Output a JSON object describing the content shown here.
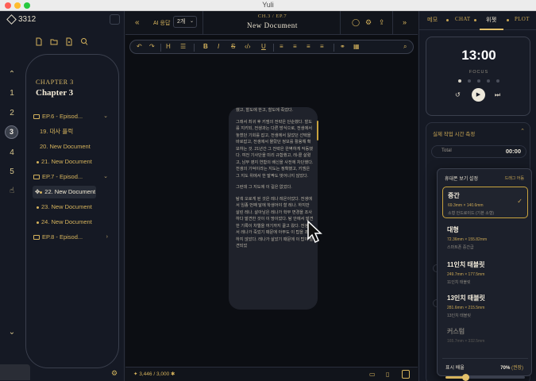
{
  "window": {
    "title": "Yuli"
  },
  "brand": {
    "name": "3312"
  },
  "rail": {
    "items": [
      "1",
      "2",
      "3",
      "4",
      "5"
    ],
    "active": "3"
  },
  "chapter": {
    "label": "CHAPTER 3",
    "title": "Chapter 3"
  },
  "tree": [
    {
      "type": "folder",
      "label": "EP.6 - Episod...",
      "chevron": "⌄"
    },
    {
      "type": "doc",
      "label": "19. 대사 플럭"
    },
    {
      "type": "doc",
      "label": "20. New Document"
    },
    {
      "type": "doc",
      "label": "21. New Document"
    },
    {
      "type": "folder",
      "label": "EP.7 - Episod...",
      "chevron": "⌄"
    },
    {
      "type": "doc",
      "label": "22. New Document",
      "active": true
    },
    {
      "type": "doc",
      "label": "23. New Document"
    },
    {
      "type": "doc",
      "label": "24. New Document"
    },
    {
      "type": "folder",
      "label": "EP.8 - Episod...",
      "chevron": "›"
    }
  ],
  "editor": {
    "ai_label": "AI 응답",
    "count_value": "2개",
    "breadcrumb": "CH.3 / EP.7",
    "title": "New Document",
    "paragraphs": [
      "했고, 할도에 한고, 할도에 죽었다.",
      "그래서 최귀 후 키엠의 전략은 단순했다. 할도를 지키되, 전생과는 다른 방식으로, 전생에서 놓쳤던 기회를 잡고, 전생에서 잃었던 선택을 바로잡고, 전생에서 몰랐던 정보를 활용해 확보하는 것. 21년간 그 전략은 완벽하게 작동했다. 여전 기사단을 미리 규합했고, 레-콜 살렸고, 남부 영지 연합의 배신을 사전에 차단했다. 전생의 기억이라는 지도는 정확했고, 키엠은 그 지도 위에서 한 발짝도 벗어나지 않았다.",
      "그런데 그 지도에 이 길은 없었다.",
      "탐색 오로게 된 것은 레나 레온이었다. 전생에서 임종 번째 달에 학생어야 할 레나. 하지만 살린 레나. 살아남은 레나가 학부 변경을 조사하다 발견한 것이 이 땅이었다. 탐 안에서 발견한 기록이 차엘을 여기까지 끌고 왔다. 전생에서 레나가 죽었기 때문에 아무도 이 탑을 조사하지 않았다. 레나가 살았기 때문에 이 탑이 발견되었"
    ],
    "word_count": "3,446 / 3,000"
  },
  "right_tabs": [
    {
      "label": "메모"
    },
    {
      "label": "CHAT"
    },
    {
      "label": "위젯",
      "active": true
    },
    {
      "label": "PLOT"
    }
  ],
  "timer": {
    "value": "13:00",
    "mode": "FOCUS",
    "progress_dots": 5,
    "active_dot": 1
  },
  "writing_section": {
    "title": "실제 작업 시간 측정",
    "total_label": "Total",
    "total_value": "00:00"
  },
  "view_menu": {
    "title": "휴대폰 보기 설정",
    "reset_label": "드래그 어듬",
    "options": [
      {
        "name": "중간",
        "dimensions": "69.3mm × 140.6mm",
        "note": "소형 안드로이드 (기본 소형)",
        "selected": true
      },
      {
        "name": "대형",
        "dimensions": "72.36mm × 155.82mm",
        "note": "스마트폰 중간급"
      },
      {
        "name": "11인치 태블릿",
        "dimensions": "249.7mm × 177.5mm",
        "note": "11인치 태블릿"
      },
      {
        "name": "13인치 태블릿",
        "dimensions": "281.6mm × 215.5mm",
        "note": "13인치 태블릿"
      },
      {
        "name": "커스텀",
        "dimensions": "165.7mm × 332.5mm",
        "note": "",
        "disabled": true
      }
    ],
    "zoom_label": "표시 배율",
    "zoom_value": "70%",
    "zoom_recommend": "(권장)",
    "zoom_fraction": 0.25
  },
  "colors": {
    "accent": "#d6b35c",
    "background": "#11141c",
    "panel": "#151924"
  }
}
